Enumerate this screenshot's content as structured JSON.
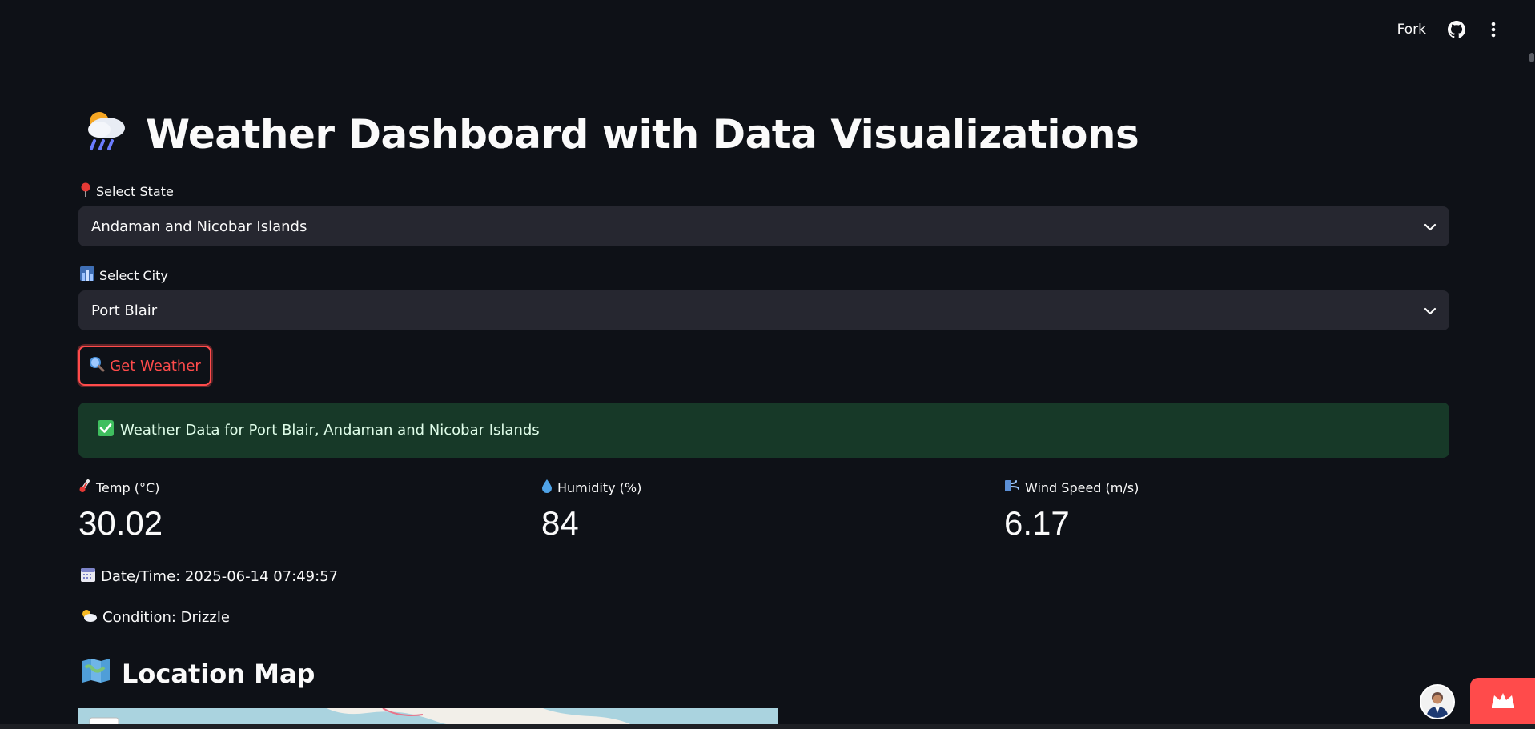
{
  "header": {
    "fork_label": "Fork",
    "icons": [
      "github-icon",
      "more-vertical-icon"
    ]
  },
  "title": {
    "emoji_icon": "cloud-rain-sun-icon",
    "text": "Weather Dashboard with Data Visualizations"
  },
  "state_select": {
    "label_icon": "pin-icon",
    "label": "Select State",
    "value": "Andaman and Nicobar Islands"
  },
  "city_select": {
    "label_icon": "cityscape-icon",
    "label": "Select City",
    "value": "Port Blair"
  },
  "get_weather_button": {
    "icon": "magnifier-icon",
    "label": "Get Weather"
  },
  "success": {
    "icon": "check-box-icon",
    "text": "Weather Data for Port Blair, Andaman and Nicobar Islands"
  },
  "metrics": [
    {
      "icon": "thermometer-icon",
      "label": "Temp (°C)",
      "value": "30.02"
    },
    {
      "icon": "droplet-icon",
      "label": "Humidity (%)",
      "value": "84"
    },
    {
      "icon": "wind-icon",
      "label": "Wind Speed (m/s)",
      "value": "6.17"
    }
  ],
  "datetime": {
    "icon": "calendar-icon",
    "text": "Date/Time: 2025-06-14 07:49:57"
  },
  "condition": {
    "icon": "sun-cloud-icon",
    "text": "Condition: Drizzle"
  },
  "map_section": {
    "icon": "map-icon",
    "title": "Location Map"
  },
  "colors": {
    "background": "#0e1117",
    "input_bg": "#262730",
    "accent": "#ff4b4b",
    "success_bg": "#173928"
  }
}
